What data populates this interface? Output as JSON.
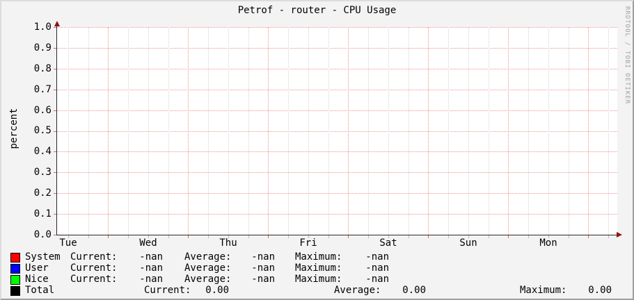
{
  "title": "Petrof - router - CPU Usage",
  "watermark": "RRDTOOL / TOBI OETIKER",
  "y_axis": {
    "label": "percent",
    "ticks": [
      "1.0",
      "0.9",
      "0.8",
      "0.7",
      "0.6",
      "0.5",
      "0.4",
      "0.3",
      "0.2",
      "0.1",
      "0.0"
    ]
  },
  "x_axis": {
    "labels": [
      "Tue",
      "Wed",
      "Thu",
      "Fri",
      "Sat",
      "Sun",
      "Mon"
    ]
  },
  "legend": {
    "columns": {
      "current": "Current:",
      "average": "Average:",
      "maximum": "Maximum:"
    },
    "rows": [
      {
        "name": "System",
        "color": "#ff0000",
        "current": "-nan",
        "average": "-nan",
        "maximum": "-nan"
      },
      {
        "name": "User",
        "color": "#0000ff",
        "current": "-nan",
        "average": "-nan",
        "maximum": "-nan"
      },
      {
        "name": "Nice",
        "color": "#00ff00",
        "current": "-nan",
        "average": "-nan",
        "maximum": "-nan"
      },
      {
        "name": "Total",
        "color": "#000000",
        "current": "0.00",
        "average": "0.00",
        "maximum": "0.00"
      }
    ]
  },
  "colors": {
    "background": "#f3f3f3",
    "canvas": "#ffffff",
    "major_grid": "#f58f8f",
    "minor_grid": "#d4d4d4",
    "axis": "#2a2a2a",
    "arrow": "#8b1515",
    "watermark_text": "#9f9f9f"
  },
  "chart_data": {
    "type": "line",
    "title": "Petrof - router - CPU Usage",
    "xlabel": "",
    "ylabel": "percent",
    "ylim": [
      0.0,
      1.0
    ],
    "y_ticks": [
      0.0,
      0.1,
      0.2,
      0.3,
      0.4,
      0.5,
      0.6,
      0.7,
      0.8,
      0.9,
      1.0
    ],
    "x_tick_labels": [
      "Tue",
      "Wed",
      "Thu",
      "Fri",
      "Sat",
      "Sun",
      "Mon"
    ],
    "grid": true,
    "legend_position": "bottom",
    "series": [
      {
        "name": "System",
        "color": "#ff0000",
        "values": [],
        "current": "-nan",
        "average": "-nan",
        "maximum": "-nan"
      },
      {
        "name": "User",
        "color": "#0000ff",
        "values": [],
        "current": "-nan",
        "average": "-nan",
        "maximum": "-nan"
      },
      {
        "name": "Nice",
        "color": "#00ff00",
        "values": [],
        "current": "-nan",
        "average": "-nan",
        "maximum": "-nan"
      },
      {
        "name": "Total",
        "color": "#000000",
        "values": [],
        "current": "0.00",
        "average": "0.00",
        "maximum": "0.00"
      }
    ]
  }
}
